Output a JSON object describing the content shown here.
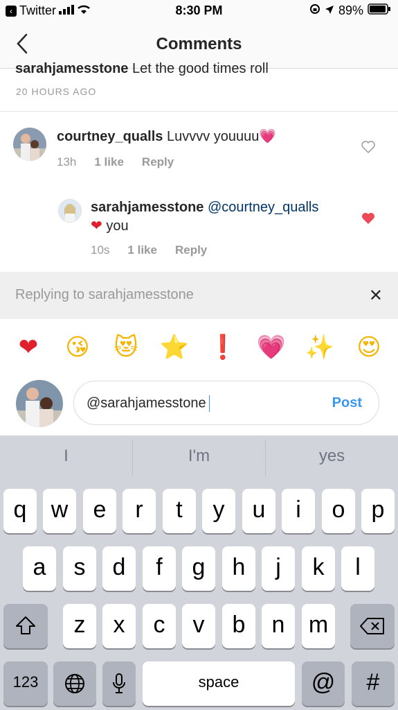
{
  "status_bar": {
    "back_app": "Twitter",
    "time": "8:30 PM",
    "battery": "89%"
  },
  "header": {
    "title": "Comments"
  },
  "caption": {
    "username": "sarahjamesstone",
    "text": "Let the good times roll",
    "time_ago": "20 HOURS AGO"
  },
  "comments": [
    {
      "username": "courtney_qualls",
      "text": "Luvvvv youuuu",
      "emoji": "💗",
      "time": "13h",
      "likes": "1 like",
      "reply_label": "Reply",
      "liked": false
    },
    {
      "username": "sarahjamesstone",
      "mention": "@courtney_qualls",
      "emoji": "❤",
      "text": "you",
      "time": "10s",
      "likes": "1 like",
      "reply_label": "Reply",
      "liked": true
    }
  ],
  "reply_banner": {
    "text": "Replying to sarahjamesstone",
    "close": "✕"
  },
  "emoji_bar": [
    "❤",
    "😘",
    "😻",
    "⭐",
    "❗",
    "💗",
    "✨",
    "😍"
  ],
  "composer": {
    "value": "@sarahjamesstone",
    "post_label": "Post"
  },
  "keyboard": {
    "suggestions": [
      "I",
      "I'm",
      "yes"
    ],
    "row1": [
      "q",
      "w",
      "e",
      "r",
      "t",
      "y",
      "u",
      "i",
      "o",
      "p"
    ],
    "row2": [
      "a",
      "s",
      "d",
      "f",
      "g",
      "h",
      "j",
      "k",
      "l"
    ],
    "row3": [
      "z",
      "x",
      "c",
      "v",
      "b",
      "n",
      "m"
    ],
    "numbers_key": "123",
    "space_key": "space",
    "at_key": "@",
    "hash_key": "#"
  },
  "colors": {
    "accent": "#3897f0",
    "heart_red": "#ed4956",
    "mention": "#003569"
  }
}
